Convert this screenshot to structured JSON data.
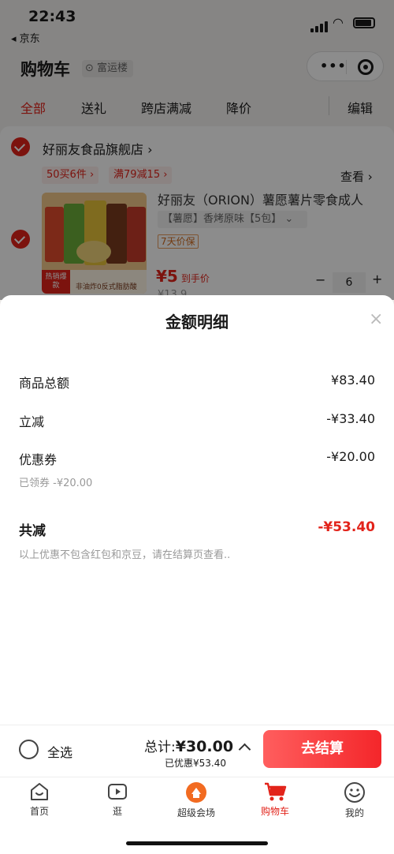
{
  "status": {
    "time": "22:43",
    "back_app": "◂ 京东"
  },
  "header": {
    "title": "购物车",
    "location": "富运楼"
  },
  "tabs": [
    {
      "label": "全部",
      "active": true
    },
    {
      "label": "送礼"
    },
    {
      "label": "跨店满减"
    },
    {
      "label": "降价"
    },
    {
      "label": "编辑"
    }
  ],
  "shop": {
    "name": "好丽友食品旗舰店 ›",
    "promos": [
      "50买6件 ›",
      "满79减15 ›"
    ],
    "look_label": "查看 ›"
  },
  "product": {
    "title": "好丽友（ORION）薯愿薯片零食成人",
    "spec": "【薯愿】香烤原味【5包】  ⌄",
    "tag": "7天价保",
    "price": "¥5",
    "price_note": "到手价",
    "quantity": "6",
    "minus": "−",
    "plus": "+",
    "old_price": "¥13.9",
    "img_badge": "热销爆款",
    "img_note": "非油炸0反式脂肪酸"
  },
  "sheet": {
    "title": "金额明细",
    "close": "×",
    "rows": [
      {
        "label": "商品总额",
        "value": "¥83.40"
      },
      {
        "label": "立减",
        "value": "-¥33.40"
      },
      {
        "label": "优惠券",
        "value": "-¥20.00"
      }
    ],
    "coupon_note": "已领券 -¥20.00",
    "total_label": "共减",
    "total_value": "-¥53.40",
    "disclaimer": "以上优惠不包含红包和京豆，请在结算页查看.."
  },
  "checkout": {
    "select_all": "全选",
    "sum_prefix": "总计:",
    "sum_value": "¥30.00",
    "saved": "已优惠¥53.40",
    "pay_button": "去结算"
  },
  "tabbar": [
    {
      "label": "首页",
      "icon": "home-icon"
    },
    {
      "label": "逛",
      "icon": "play-icon"
    },
    {
      "label": "超级会场",
      "icon": "venue-icon"
    },
    {
      "label": "购物车",
      "icon": "cart-icon",
      "active": true
    },
    {
      "label": "我的",
      "icon": "smile-icon"
    }
  ],
  "colors": {
    "accent": "#e2231a"
  }
}
